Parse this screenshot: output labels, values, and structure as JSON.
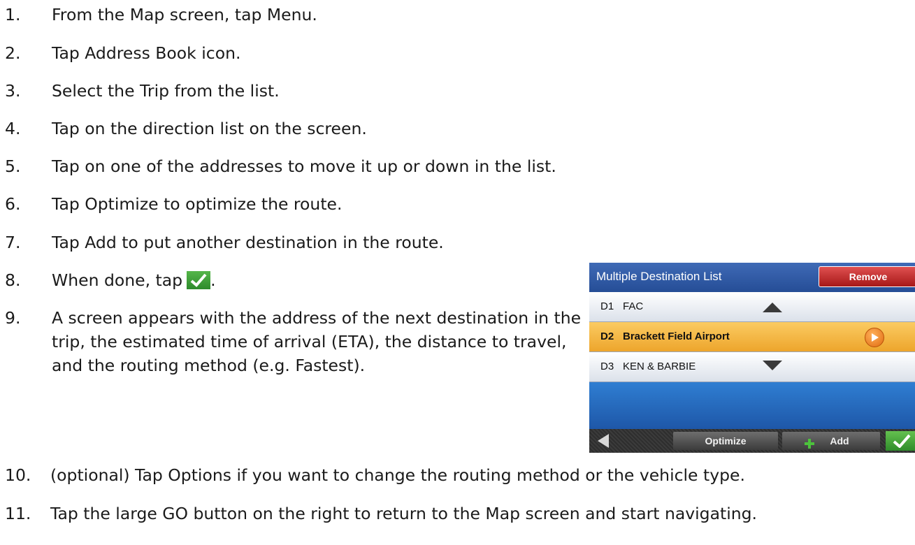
{
  "steps": [
    {
      "num": "1.",
      "text": "From the Map screen, tap Menu."
    },
    {
      "num": "2.",
      "text": "Tap Address Book icon."
    },
    {
      "num": "3.",
      "text": "Select the Trip from the list."
    },
    {
      "num": "4.",
      "text": "Tap on the direction list on the screen."
    },
    {
      "num": "5.",
      "text": "Tap on one of the addresses to move it up or down in the list."
    },
    {
      "num": "6.",
      "text": "Tap Optimize to optimize the route."
    },
    {
      "num": "7.",
      "text": "Tap Add to put another destination in the route."
    },
    {
      "num": "8.",
      "text": "When done, tap",
      "suffix": "."
    },
    {
      "num": "9.",
      "text": " A screen appears with the address of the next destination in the trip, the estimated time of arrival (ETA), the distance to travel, and the routing method (e.g. Fastest)."
    },
    {
      "num": "10.",
      "text": "(optional) Tap Options if you want to change the routing method or the vehicle type."
    },
    {
      "num": "11.",
      "text": "Tap the large GO button on the right to return to the Map screen and start navigating."
    }
  ],
  "inline_icon": "checkmark-icon",
  "device": {
    "title": "Multiple Destination List",
    "remove_label": "Remove",
    "rows": [
      {
        "label": "D1",
        "name": "FAC"
      },
      {
        "label": "D2",
        "name": "Brackett Field Airport"
      },
      {
        "label": "D3",
        "name": "KEN & BARBIE"
      }
    ],
    "optimize_label": "Optimize",
    "add_label": "Add",
    "colors": {
      "header": "#2a5299",
      "selected_row": "#f2b240",
      "remove": "#c62828",
      "confirm": "#3a9a32"
    }
  }
}
